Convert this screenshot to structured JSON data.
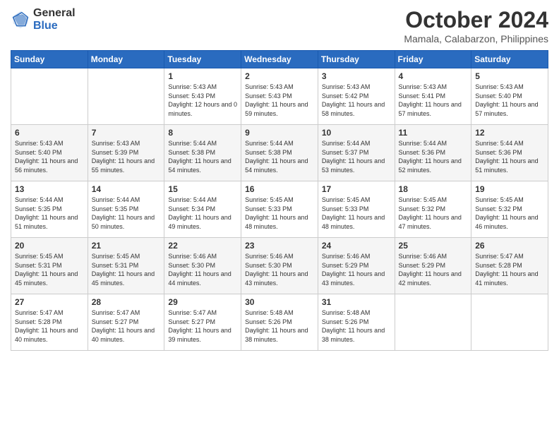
{
  "logo": {
    "general": "General",
    "blue": "Blue"
  },
  "title": {
    "month": "October 2024",
    "location": "Mamala, Calabarzon, Philippines"
  },
  "weekdays": [
    "Sunday",
    "Monday",
    "Tuesday",
    "Wednesday",
    "Thursday",
    "Friday",
    "Saturday"
  ],
  "weeks": [
    [
      {
        "day": "",
        "info": ""
      },
      {
        "day": "",
        "info": ""
      },
      {
        "day": "1",
        "info": "Sunrise: 5:43 AM\nSunset: 5:43 PM\nDaylight: 12 hours and 0 minutes."
      },
      {
        "day": "2",
        "info": "Sunrise: 5:43 AM\nSunset: 5:43 PM\nDaylight: 11 hours and 59 minutes."
      },
      {
        "day": "3",
        "info": "Sunrise: 5:43 AM\nSunset: 5:42 PM\nDaylight: 11 hours and 58 minutes."
      },
      {
        "day": "4",
        "info": "Sunrise: 5:43 AM\nSunset: 5:41 PM\nDaylight: 11 hours and 57 minutes."
      },
      {
        "day": "5",
        "info": "Sunrise: 5:43 AM\nSunset: 5:40 PM\nDaylight: 11 hours and 57 minutes."
      }
    ],
    [
      {
        "day": "6",
        "info": "Sunrise: 5:43 AM\nSunset: 5:40 PM\nDaylight: 11 hours and 56 minutes."
      },
      {
        "day": "7",
        "info": "Sunrise: 5:43 AM\nSunset: 5:39 PM\nDaylight: 11 hours and 55 minutes."
      },
      {
        "day": "8",
        "info": "Sunrise: 5:44 AM\nSunset: 5:38 PM\nDaylight: 11 hours and 54 minutes."
      },
      {
        "day": "9",
        "info": "Sunrise: 5:44 AM\nSunset: 5:38 PM\nDaylight: 11 hours and 54 minutes."
      },
      {
        "day": "10",
        "info": "Sunrise: 5:44 AM\nSunset: 5:37 PM\nDaylight: 11 hours and 53 minutes."
      },
      {
        "day": "11",
        "info": "Sunrise: 5:44 AM\nSunset: 5:36 PM\nDaylight: 11 hours and 52 minutes."
      },
      {
        "day": "12",
        "info": "Sunrise: 5:44 AM\nSunset: 5:36 PM\nDaylight: 11 hours and 51 minutes."
      }
    ],
    [
      {
        "day": "13",
        "info": "Sunrise: 5:44 AM\nSunset: 5:35 PM\nDaylight: 11 hours and 51 minutes."
      },
      {
        "day": "14",
        "info": "Sunrise: 5:44 AM\nSunset: 5:35 PM\nDaylight: 11 hours and 50 minutes."
      },
      {
        "day": "15",
        "info": "Sunrise: 5:44 AM\nSunset: 5:34 PM\nDaylight: 11 hours and 49 minutes."
      },
      {
        "day": "16",
        "info": "Sunrise: 5:45 AM\nSunset: 5:33 PM\nDaylight: 11 hours and 48 minutes."
      },
      {
        "day": "17",
        "info": "Sunrise: 5:45 AM\nSunset: 5:33 PM\nDaylight: 11 hours and 48 minutes."
      },
      {
        "day": "18",
        "info": "Sunrise: 5:45 AM\nSunset: 5:32 PM\nDaylight: 11 hours and 47 minutes."
      },
      {
        "day": "19",
        "info": "Sunrise: 5:45 AM\nSunset: 5:32 PM\nDaylight: 11 hours and 46 minutes."
      }
    ],
    [
      {
        "day": "20",
        "info": "Sunrise: 5:45 AM\nSunset: 5:31 PM\nDaylight: 11 hours and 45 minutes."
      },
      {
        "day": "21",
        "info": "Sunrise: 5:45 AM\nSunset: 5:31 PM\nDaylight: 11 hours and 45 minutes."
      },
      {
        "day": "22",
        "info": "Sunrise: 5:46 AM\nSunset: 5:30 PM\nDaylight: 11 hours and 44 minutes."
      },
      {
        "day": "23",
        "info": "Sunrise: 5:46 AM\nSunset: 5:30 PM\nDaylight: 11 hours and 43 minutes."
      },
      {
        "day": "24",
        "info": "Sunrise: 5:46 AM\nSunset: 5:29 PM\nDaylight: 11 hours and 43 minutes."
      },
      {
        "day": "25",
        "info": "Sunrise: 5:46 AM\nSunset: 5:29 PM\nDaylight: 11 hours and 42 minutes."
      },
      {
        "day": "26",
        "info": "Sunrise: 5:47 AM\nSunset: 5:28 PM\nDaylight: 11 hours and 41 minutes."
      }
    ],
    [
      {
        "day": "27",
        "info": "Sunrise: 5:47 AM\nSunset: 5:28 PM\nDaylight: 11 hours and 40 minutes."
      },
      {
        "day": "28",
        "info": "Sunrise: 5:47 AM\nSunset: 5:27 PM\nDaylight: 11 hours and 40 minutes."
      },
      {
        "day": "29",
        "info": "Sunrise: 5:47 AM\nSunset: 5:27 PM\nDaylight: 11 hours and 39 minutes."
      },
      {
        "day": "30",
        "info": "Sunrise: 5:48 AM\nSunset: 5:26 PM\nDaylight: 11 hours and 38 minutes."
      },
      {
        "day": "31",
        "info": "Sunrise: 5:48 AM\nSunset: 5:26 PM\nDaylight: 11 hours and 38 minutes."
      },
      {
        "day": "",
        "info": ""
      },
      {
        "day": "",
        "info": ""
      }
    ]
  ]
}
